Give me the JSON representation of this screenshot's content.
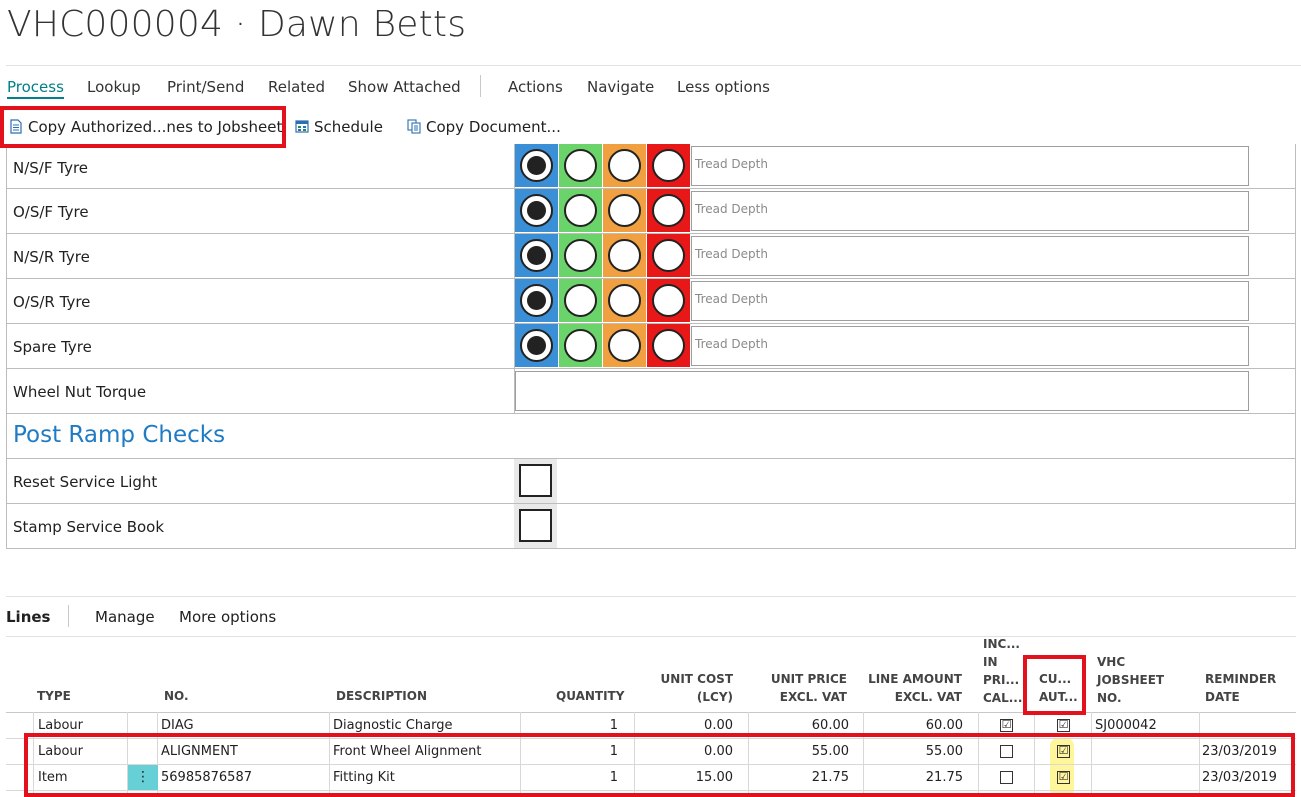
{
  "page": {
    "title": "VHC000004 · Dawn Betts"
  },
  "menu": {
    "tabs": [
      {
        "label": "Process"
      },
      {
        "label": "Lookup"
      },
      {
        "label": "Print/Send"
      },
      {
        "label": "Related"
      },
      {
        "label": "Show Attached"
      },
      {
        "label": "Actions"
      },
      {
        "label": "Navigate"
      },
      {
        "label": "Less options"
      }
    ]
  },
  "actions": {
    "copy_authorized": "Copy Authorized...nes to Jobsheet",
    "schedule": "Schedule",
    "copy_document": "Copy Document..."
  },
  "checks": {
    "tread_placeholder": "Tread Depth",
    "tyres": [
      {
        "label": "N/S/F Tyre"
      },
      {
        "label": "O/S/F Tyre"
      },
      {
        "label": "N/S/R Tyre"
      },
      {
        "label": "O/S/R Tyre"
      },
      {
        "label": "Spare Tyre"
      }
    ],
    "wheel_nut": "Wheel Nut Torque",
    "post_ramp_title": "Post Ramp Checks",
    "post_ramp": [
      {
        "label": "Reset Service Light"
      },
      {
        "label": "Stamp Service Book"
      }
    ],
    "status_colors": [
      "#3b8fd6",
      "#6ad36a",
      "#f0a040",
      "#e81818"
    ]
  },
  "lines": {
    "tabs": {
      "lines": "Lines",
      "manage": "Manage",
      "more": "More options"
    },
    "headers": {
      "type": "TYPE",
      "no": "NO.",
      "description": "DESCRIPTION",
      "quantity": "QUANTITY",
      "unit_cost_1": "UNIT COST",
      "unit_cost_2": "(LCY)",
      "unit_price_1": "UNIT PRICE",
      "unit_price_2": "EXCL. VAT",
      "line_amount_1": "LINE AMOUNT",
      "line_amount_2": "EXCL. VAT",
      "inc_1": "INC...",
      "inc_2": "IN",
      "inc_3": "PRI...",
      "inc_4": "CAL...",
      "cu_1": "CU...",
      "cu_2": "AUT...",
      "vhc_1": "VHC",
      "vhc_2": "JOBSHEET",
      "vhc_3": "NO.",
      "rem_1": "REMINDER",
      "rem_2": "DATE"
    },
    "rows": [
      {
        "type": "Labour",
        "no": "DIAG",
        "description": "Diagnostic Charge",
        "quantity": "1",
        "unit_cost": "0.00",
        "unit_price": "60.00",
        "line_amount": "60.00",
        "inc": "☑",
        "cust_auth": "☑",
        "jobsheet": "SJ000042",
        "reminder": ""
      },
      {
        "type": "Labour",
        "no": "ALIGNMENT",
        "description": "Front Wheel Alignment",
        "quantity": "1",
        "unit_cost": "0.00",
        "unit_price": "55.00",
        "line_amount": "55.00",
        "inc": "",
        "cust_auth": "☑",
        "jobsheet": "",
        "reminder": "23/03/2019"
      },
      {
        "type": "Item",
        "no": "56985876587",
        "description": "Fitting Kit",
        "quantity": "1",
        "unit_cost": "15.00",
        "unit_price": "21.75",
        "line_amount": "21.75",
        "inc": "",
        "cust_auth": "☑",
        "jobsheet": "",
        "reminder": "23/03/2019"
      }
    ],
    "row_menu_glyph": "⋮"
  }
}
